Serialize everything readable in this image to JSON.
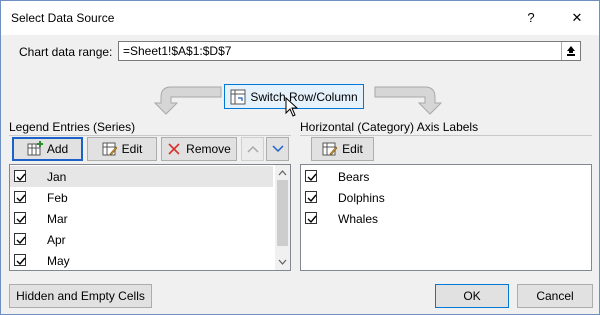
{
  "window": {
    "title": "Select Data Source",
    "help_label": "?",
    "close_label": "✕"
  },
  "range": {
    "label": "Chart data range:",
    "value": "=Sheet1!$A$1:$D$7"
  },
  "switch_button": {
    "label": "Switch Row/Column"
  },
  "legend": {
    "title": "Legend Entries (Series)",
    "add_label": "Add",
    "edit_label": "Edit",
    "remove_label": "Remove",
    "items": [
      {
        "label": "Jan",
        "checked": true,
        "selected": true
      },
      {
        "label": "Feb",
        "checked": true,
        "selected": false
      },
      {
        "label": "Mar",
        "checked": true,
        "selected": false
      },
      {
        "label": "Apr",
        "checked": true,
        "selected": false
      },
      {
        "label": "May",
        "checked": true,
        "selected": false
      }
    ]
  },
  "axis": {
    "title": "Horizontal (Category) Axis Labels",
    "edit_label": "Edit",
    "items": [
      {
        "label": "Bears",
        "checked": true
      },
      {
        "label": "Dolphins",
        "checked": true
      },
      {
        "label": "Whales",
        "checked": true
      }
    ]
  },
  "footer": {
    "hidden_label": "Hidden and Empty Cells",
    "ok_label": "OK",
    "cancel_label": "Cancel"
  },
  "colors": {
    "accent": "#0078d7",
    "border": "#adadad",
    "button_bg": "#e1e1e1",
    "remove_x": "#d9302c"
  }
}
